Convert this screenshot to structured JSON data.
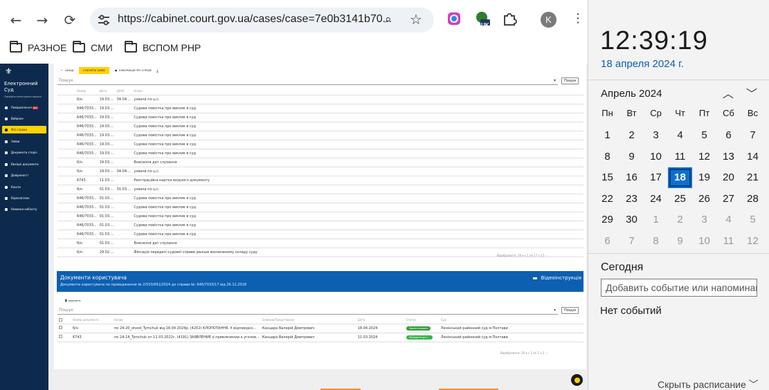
{
  "browser": {
    "url": "https://cabinet.court.gov.ua/cases/case=7e0b3141b70...",
    "profile_initial": "K",
    "ext_badge": "UK",
    "bookmarks": [
      "РАЗНОЕ",
      "СМИ",
      "ВСПОМ РНР"
    ]
  },
  "sidebar": {
    "brand_line1": "Електронний",
    "brand_line2": "Суд",
    "brand_sub": "Офіційна електронна адреса",
    "items": [
      {
        "label": "Повідомлення",
        "badge": "99+"
      },
      {
        "label": "Вибране"
      },
      {
        "label": "Мої справи",
        "active": true
      },
      {
        "label": "Заяви"
      },
      {
        "label": "Документи сторін"
      },
      {
        "label": "Вихідні документи"
      },
      {
        "label": "Довіреності"
      },
      {
        "label": "Кошти"
      },
      {
        "label": "Відеозв'язок"
      },
      {
        "label": "Новинки кабінету"
      }
    ]
  },
  "case_toolbar": {
    "back": "НАЗАД",
    "create": "СТВОРИТИ ЗАЯВУ",
    "info": "ІНФОРМАЦІЯ ПРО СПРАВУ"
  },
  "search_placeholder": "Пошук",
  "search_button": "Пошук",
  "events": {
    "headers": [
      "Номер",
      "Дата",
      "ДНЗС",
      "Назва"
    ],
    "rows": [
      [
        "б/н",
        "19.03....",
        "04.04....",
        "ухвала по ц.с."
      ],
      [
        "646/7033...",
        "19.03....",
        "",
        "Судова повістка про виклик в суд"
      ],
      [
        "646/7033...",
        "19.03....",
        "",
        "Судова повістка про виклик в суд"
      ],
      [
        "646/7033...",
        "19.03....",
        "",
        "Судова повістка про виклик в суд"
      ],
      [
        "646/7033...",
        "19.03....",
        "",
        "Судова повістка про виклик в суд"
      ],
      [
        "646/7033...",
        "19.03....",
        "",
        "Судова повістка про виклик в суд"
      ],
      [
        "646/7033...",
        "19.03....",
        "",
        "Судова повістка про виклик в суд"
      ],
      [
        "б/н",
        "19.03....",
        "",
        "Внесення дат слухання"
      ],
      [
        "б/н",
        "19.03....",
        "04.04....",
        "ухвала по ц.с."
      ],
      [
        "6743",
        "11.03....",
        "",
        "Реєстраційна картка вхідного документу"
      ],
      [
        "б/н",
        "01.03....",
        "01.03....",
        "ухвала по ц.с."
      ],
      [
        "646/7033...",
        "01.03....",
        "",
        "Судова повістка про виклик в суд"
      ],
      [
        "646/7033...",
        "01.03....",
        "",
        "Судова повістка про виклик в суд"
      ],
      [
        "646/7033...",
        "01.03....",
        "",
        "Судова повістка про виклик в суд"
      ],
      [
        "646/7033...",
        "01.03....",
        "",
        "Судова повістка про виклик в суд"
      ],
      [
        "646/7033...",
        "01.03....",
        "",
        "Судова повістка про виклик в суд"
      ],
      [
        "б/н",
        "01.03....",
        "",
        "Внесення дат слухання"
      ],
      [
        "б/н",
        "29.02....",
        "",
        "Фіксація передачі судової справи раніше визначеному складу суду"
      ]
    ],
    "pager": "Відображати:  20  ▾      с 1 по 17 с 17     ‹     ›"
  },
  "user_docs": {
    "title": "Документи користувача",
    "subtitle": "Документи користувача по провадженню № 2/553/691/2024 до справи №: 646/7033/17 від 26.12.2018",
    "video_link": "Відеоінструкція",
    "action": "видалити",
    "headers": [
      "",
      "Номер документа",
      "Назва",
      "Заявник/Представник",
      "Дата",
      "Статус",
      "Суд"
    ],
    "rows": [
      {
        "num": "б/н",
        "name": "по 24-20_otvod_Tymchuk від 18.04.2024р. (4202) КЛОПОТАННЯ. У відповідно...",
        "applicant": "Канцара Валерій Дмитрович",
        "date": "18.04.2024",
        "status": "Зареєстровано",
        "court": "Ленінський районний суд м.Полтави"
      },
      {
        "num": "6743",
        "name": "по 24-14_Tymchuk от 11.03.2022г. (4191) ЗАЯВЛЕНИЕ о привлечении к уголов...",
        "applicant": "Канцара Валерій Дмитрович",
        "date": "11.03.2024",
        "status": "Передано до с...",
        "court": "Ленінський районний суд м.Полтави"
      }
    ],
    "pager": "Відображати:  20  ▾      с 1 по 2 з 2     ‹     ›"
  },
  "colors": {
    "sidebar": "#0d2a4d",
    "accent_yellow": "#ffd200",
    "docs_header": "#0d5fb1",
    "status_green": "#2e9e3a"
  },
  "clock": {
    "time": "12:39:19",
    "date": "18 апреля 2024 г.",
    "month": "Апрель 2024",
    "weekdays": [
      "Пн",
      "Вт",
      "Ср",
      "Чт",
      "Пт",
      "Сб",
      "Вс"
    ],
    "weeks": [
      [
        "1",
        "2",
        "3",
        "4",
        "5",
        "6",
        "7"
      ],
      [
        "8",
        "9",
        "10",
        "11",
        "12",
        "13",
        "14"
      ],
      [
        "15",
        "16",
        "17",
        "18",
        "19",
        "20",
        "21"
      ],
      [
        "22",
        "23",
        "24",
        "25",
        "26",
        "27",
        "28"
      ],
      [
        "29",
        "30",
        "1",
        "2",
        "3",
        "4",
        "5"
      ],
      [
        "6",
        "7",
        "8",
        "9",
        "10",
        "11",
        "12"
      ]
    ],
    "today": "18",
    "today_label": "Сегодня",
    "event_placeholder": "Добавить событие или напоминание",
    "no_events": "Нет событий",
    "collapse": "Скрыть расписание"
  }
}
